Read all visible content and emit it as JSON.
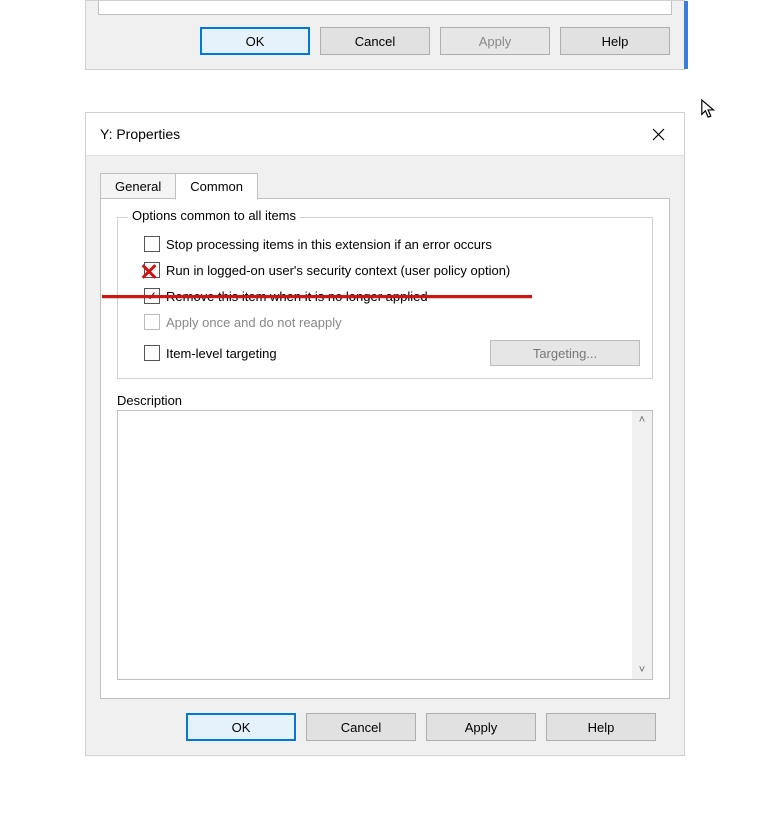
{
  "top_dialog": {
    "ok": "OK",
    "cancel": "Cancel",
    "apply": "Apply",
    "help": "Help"
  },
  "main_dialog": {
    "title": "Y: Properties",
    "tabs": {
      "general": "General",
      "common": "Common"
    },
    "fieldset_legend": "Options common to all items",
    "options": {
      "stop_processing": "Stop processing items in this extension if an error occurs",
      "run_logged_on": "Run in logged-on user's security context (user policy option)",
      "remove_item": "Remove this item when it is no longer applied",
      "apply_once": "Apply once and do not reapply",
      "item_level_targeting": "Item-level targeting"
    },
    "targeting_button": "Targeting...",
    "description_label": "Description",
    "buttons": {
      "ok": "OK",
      "cancel": "Cancel",
      "apply": "Apply",
      "help": "Help"
    }
  }
}
